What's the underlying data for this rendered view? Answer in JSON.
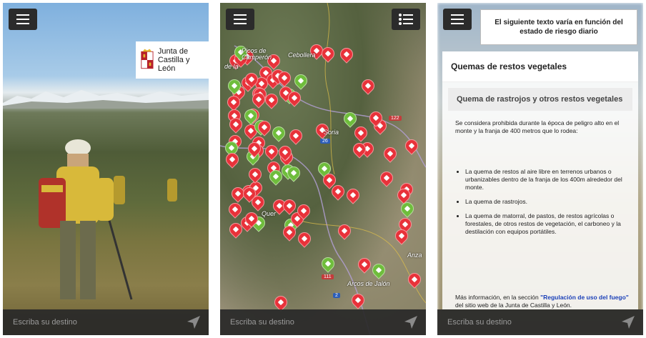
{
  "screen1": {
    "menu_icon": "hamburger-icon",
    "brand": {
      "line1": "Junta de",
      "line2": "Castilla y León"
    },
    "search": {
      "placeholder": "Escriba su destino"
    },
    "nav_icon": "navigation-arrow-icon"
  },
  "screen2": {
    "menu_icon": "hamburger-icon",
    "legend_icon": "list-icon",
    "labels": [
      "Picos de",
      "Camperón",
      "Cebollera",
      "de la",
      "Soria",
      "Quer",
      "Arcos de",
      "Arcos de Jalón",
      "Anza"
    ],
    "roads": [
      "122",
      "26",
      "111",
      "2"
    ],
    "search": {
      "placeholder": "Escriba su destino"
    },
    "nav_icon": "navigation-arrow-icon"
  },
  "screen3": {
    "menu_icon": "hamburger-icon",
    "notice": "El siguiente texto varía en función del estado de riesgo diario",
    "title": "Quemas de restos vegetales",
    "subtitle": "Quema de rastrojos y otros restos vegetales",
    "intro": "Se considera prohibida durante la época de peligro alto en el monte y la franja de 400 metros que lo rodea:",
    "items": [
      "La quema de restos al aire libre en terrenos urbanos o urbanizables dentro de la franja de los 400m alrededor del monte.",
      "La quema de rastrojos.",
      "La quema de matorral, de pastos, de restos agrícolas o forestales, de otros restos de vegetación, el carboneo y la destilación con equipos portátiles."
    ],
    "more_prefix": "Más información, en la sección ",
    "more_link": "\"Regulación de uso del fuego\"",
    "more_suffix": " del sitio web de la Junta de Castilla y León.",
    "search": {
      "placeholder": "Escriba su destino"
    },
    "nav_icon": "navigation-arrow-icon"
  },
  "colors": {
    "pin_red": "#e8323a",
    "pin_green": "#6fbd3c",
    "link": "#1a3fb8",
    "bar": "#2b2b2b"
  }
}
